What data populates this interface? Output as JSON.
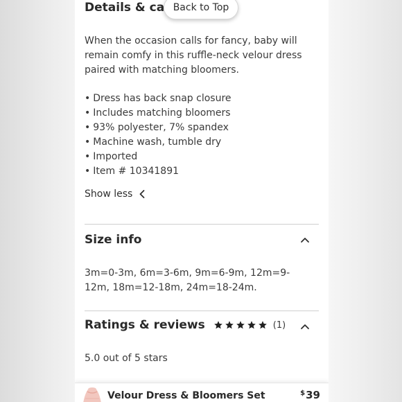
{
  "details": {
    "title": "Details & care",
    "back_to_top": "Back to Top",
    "description": "When the occasion calls for fancy, baby will remain comfy in this ruffle-neck velour dress paired with matching bloomers.",
    "bullets": [
      "Dress has back snap closure",
      "Includes matching bloomers",
      "93% polyester, 7% spandex",
      "Machine wash, tumble dry",
      "Imported",
      "Item # 10341891"
    ],
    "show_less": "Show less"
  },
  "size_info": {
    "title": "Size info",
    "text": "3m=0-3m, 6m=3-6m, 9m=6-9m, 12m=9-12m, 18m=12-18m, 24m=18-24m."
  },
  "ratings": {
    "title": "Ratings & reviews",
    "stars": 5,
    "count": "(1)",
    "summary": "5.0 out of 5 stars"
  },
  "sticky_bar": {
    "product_name": "Velour Dress & Bloomers Set",
    "currency": "$",
    "price": "39"
  },
  "colors": {
    "text": "#2e2e2e",
    "divider": "#cfcfcf",
    "star": "#222222",
    "thumbnail": "#f2c7bf"
  },
  "icons": {
    "show_less": "chevron-left-icon",
    "collapse": "chevron-up-icon",
    "rating": "star-icon"
  }
}
